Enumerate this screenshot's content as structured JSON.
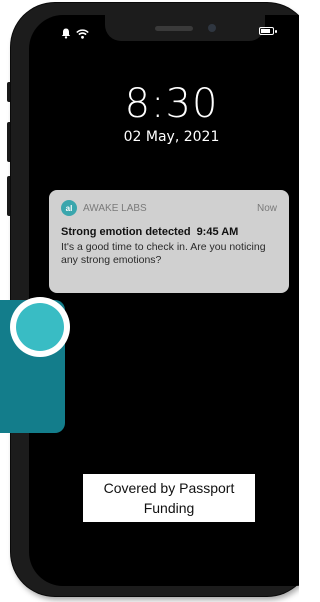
{
  "status_bar": {
    "alarm_icon": "bell-icon",
    "wifi_icon": "wifi-icon",
    "battery_icon": "battery-icon"
  },
  "lock_screen": {
    "time": "8:30",
    "date": "02 May, 2021"
  },
  "notification": {
    "app_icon_text": "al",
    "app_name": "AWAKE LABS",
    "received": "Now",
    "title": "Strong emotion detected",
    "event_time": "9:45 AM",
    "body": "It's a good time to check in. Are you noticing any strong emotions?"
  },
  "caption": {
    "line1": "Covered by Passport",
    "line2": "Funding"
  },
  "colors": {
    "teal_dark": "#137d8b",
    "teal_light": "#39bcc4",
    "notification_bg": "#d0d0d0"
  }
}
